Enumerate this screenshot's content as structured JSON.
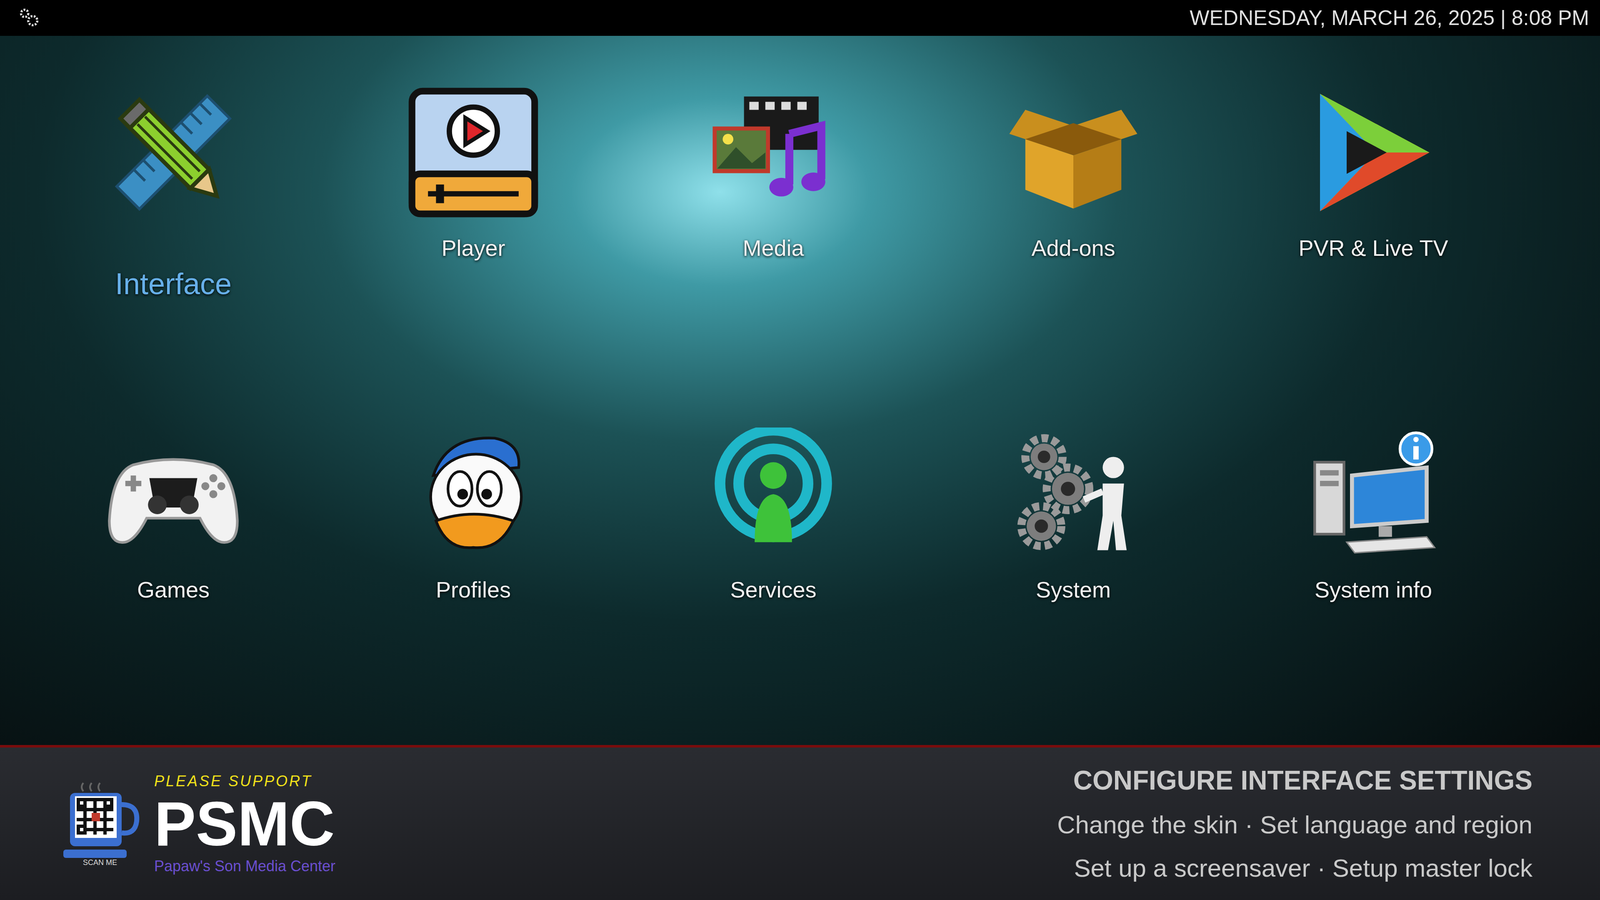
{
  "top_bar": {
    "datetime": "WEDNESDAY, MARCH 26, 2025 | 8:08 PM"
  },
  "menu": [
    {
      "label": "Interface",
      "selected": true
    },
    {
      "label": "Player",
      "selected": false
    },
    {
      "label": "Media",
      "selected": false
    },
    {
      "label": "Add-ons",
      "selected": false
    },
    {
      "label": "PVR & Live TV",
      "selected": false
    },
    {
      "label": "Games",
      "selected": false
    },
    {
      "label": "Profiles",
      "selected": false
    },
    {
      "label": "Services",
      "selected": false
    },
    {
      "label": "System",
      "selected": false
    },
    {
      "label": "System info",
      "selected": false
    }
  ],
  "info": {
    "title": "CONFIGURE INTERFACE SETTINGS",
    "lines": [
      "Change the skin · Set language and region",
      "Set up a screensaver · Setup master lock"
    ]
  },
  "branding": {
    "tagline": "PLEASE SUPPORT",
    "name": "PSMC",
    "subtitle": "Papaw's Son Media Center",
    "qr_caption": "SCAN ME"
  }
}
